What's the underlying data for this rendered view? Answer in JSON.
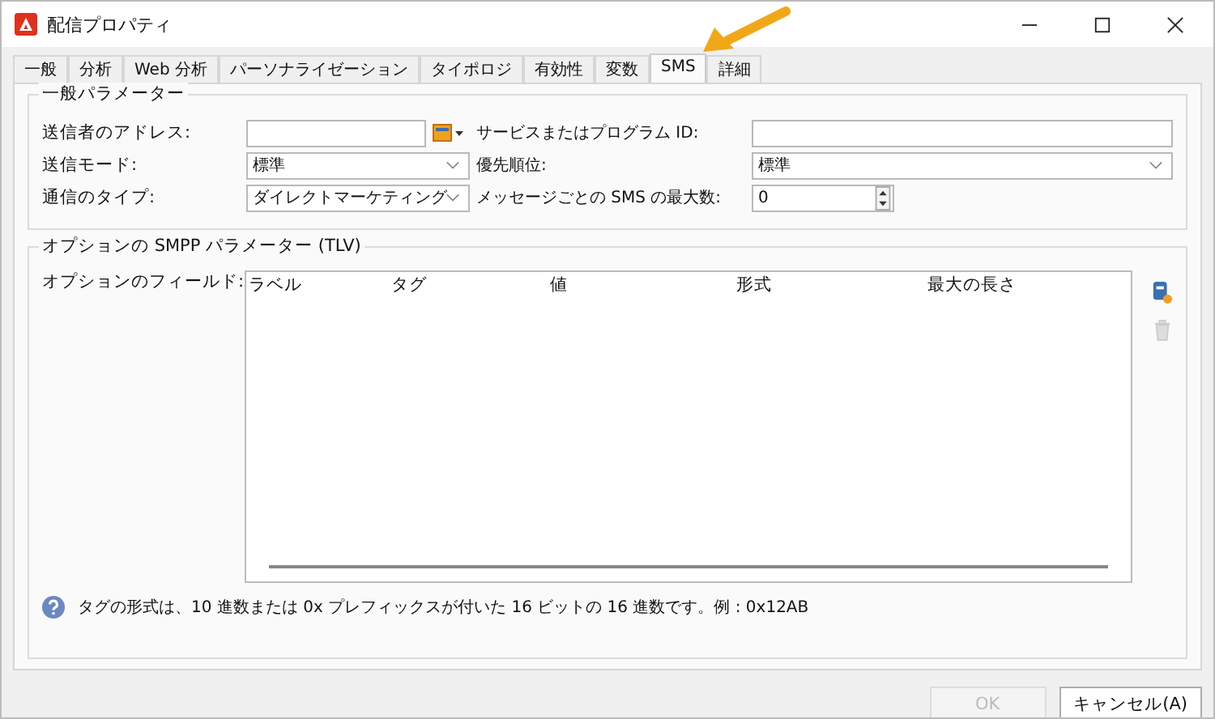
{
  "window": {
    "title": "配信プロパティ"
  },
  "tabs": [
    {
      "label": "一般",
      "selected": false
    },
    {
      "label": "分析",
      "selected": false
    },
    {
      "label": "Web 分析",
      "selected": false
    },
    {
      "label": "パーソナライゼーション",
      "selected": false
    },
    {
      "label": "タイポロジ",
      "selected": false
    },
    {
      "label": "有効性",
      "selected": false
    },
    {
      "label": "変数",
      "selected": false
    },
    {
      "label": "SMS",
      "selected": true
    },
    {
      "label": "詳細",
      "selected": false
    }
  ],
  "general": {
    "title": "一般パラメーター",
    "rows": [
      [
        {
          "kind": "label",
          "text": "送信者のアドレス:"
        },
        {
          "kind": "text",
          "picker": true
        },
        {
          "kind": "label",
          "text": "サービスまたはプログラム ID:"
        },
        {
          "kind": "text",
          "picker": false
        }
      ],
      [
        {
          "kind": "label",
          "text": "送信モード:"
        },
        {
          "kind": "select",
          "value": "標準"
        },
        {
          "kind": "label",
          "text": "優先順位:"
        },
        {
          "kind": "select",
          "value": "標準"
        }
      ],
      [
        {
          "kind": "label",
          "text": "通信のタイプ:"
        },
        {
          "kind": "select",
          "value": "ダイレクトマーケティング"
        },
        {
          "kind": "label",
          "text": "メッセージごとの SMS の最大数:"
        },
        {
          "kind": "spin",
          "value": "0"
        }
      ]
    ]
  },
  "smpp": {
    "title": "オプションの SMPP パラメーター (TLV)",
    "field_label": "オプションのフィールド:",
    "table": {
      "columns": [
        "ラベル",
        "タグ",
        "値",
        "形式",
        "最大の長さ"
      ]
    },
    "help": "タグの形式は、10 進数または 0x プレフィックスが付いた 16 ビットの 16 進数です。例 : 0x12AB"
  },
  "buttons": [
    {
      "label": "OK",
      "disabled": true
    },
    {
      "label": "キャンセル(A)",
      "disabled": false
    }
  ]
}
